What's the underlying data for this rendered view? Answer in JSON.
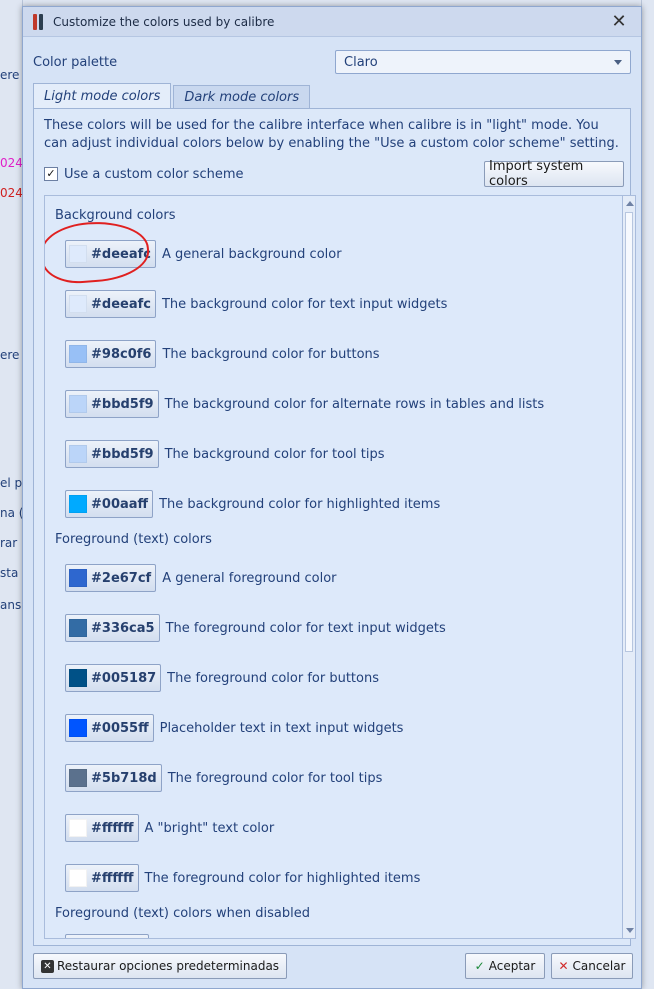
{
  "dialog": {
    "title": "Customize the colors used by calibre",
    "palette_label": "Color palette",
    "palette_value": "Claro"
  },
  "tabs": [
    {
      "label": "Light mode colors",
      "active": true
    },
    {
      "label": "Dark mode colors",
      "active": false
    }
  ],
  "panel": {
    "description": "These colors will be used for the calibre interface when calibre is in \"light\" mode. You can adjust individual colors below by enabling the \"Use a custom color scheme\" setting.",
    "custom_scheme_label": "Use a custom color scheme",
    "custom_scheme_checked": true,
    "checkbox_mark": "✓",
    "import_button": "Import system colors"
  },
  "sections": [
    {
      "heading": "Background colors",
      "rows": [
        {
          "hex": "#deeafc",
          "desc": "A general background color"
        },
        {
          "hex": "#deeafc",
          "desc": "The background color for text input widgets"
        },
        {
          "hex": "#98c0f6",
          "desc": "The background color for buttons"
        },
        {
          "hex": "#bbd5f9",
          "desc": "The background color for alternate rows in tables and lists"
        },
        {
          "hex": "#bbd5f9",
          "desc": "The background color for tool tips"
        },
        {
          "hex": "#00aaff",
          "desc": "The background color for highlighted items"
        }
      ]
    },
    {
      "heading": "Foreground (text) colors",
      "rows": [
        {
          "hex": "#2e67cf",
          "desc": "A general foreground color"
        },
        {
          "hex": "#336ca5",
          "desc": "The foreground color for text input widgets"
        },
        {
          "hex": "#005187",
          "desc": "The foreground color for buttons"
        },
        {
          "hex": "#0055ff",
          "desc": "Placeholder text in text input widgets"
        },
        {
          "hex": "#5b718d",
          "desc": "The foreground color for tool tips"
        },
        {
          "hex": "#ffffff",
          "desc": "A \"bright\" text color"
        },
        {
          "hex": "#ffffff",
          "desc": "The foreground color for highlighted items"
        }
      ]
    },
    {
      "heading": "Foreground (text) colors when disabled",
      "rows": []
    }
  ],
  "footer": {
    "restore_button": "Restaurar opciones predeterminadas",
    "accept_button": "Aceptar",
    "cancel_button": "Cancelar"
  },
  "background_app": {
    "left_texts": [
      {
        "text": "ere",
        "color": "#23417a"
      },
      {
        "text": "024",
        "color": "#e020c8"
      },
      {
        "text": "024",
        "color": "#d02020"
      },
      {
        "text": "ere",
        "color": "#23417a"
      },
      {
        "text": "el p",
        "color": "#23417a"
      },
      {
        "text": "na (",
        "color": "#23417a"
      },
      {
        "text": "rar",
        "color": "#23417a"
      },
      {
        "text": "sta",
        "color": "#23417a"
      },
      {
        "text": "ans",
        "color": "#23417a"
      }
    ]
  }
}
